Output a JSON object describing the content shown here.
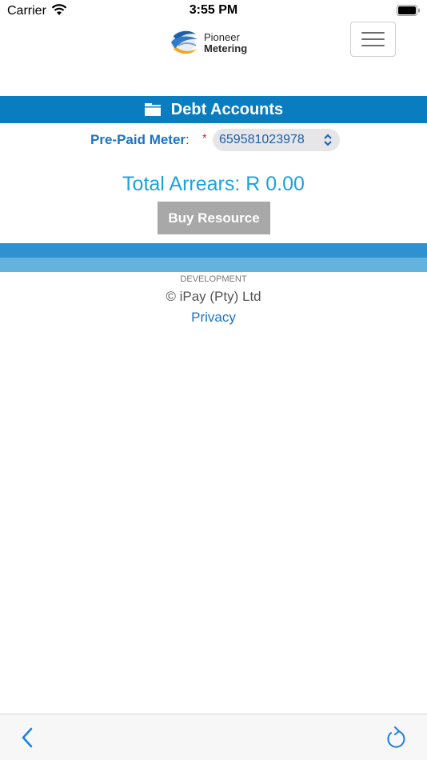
{
  "status_bar": {
    "carrier": "Carrier",
    "time": "3:55 PM"
  },
  "header": {
    "logo_line1": "Pioneer",
    "logo_line2": "Metering"
  },
  "page": {
    "title": "Debt Accounts"
  },
  "meter": {
    "label": "Pre-Paid Meter",
    "colon": ":",
    "required_mark": "*",
    "selected_value": "659581023978"
  },
  "arrears": {
    "text": "Total Arrears: R 0.00"
  },
  "actions": {
    "buy_label": "Buy Resource"
  },
  "footer": {
    "environment": "DEVELOPMENT",
    "copyright": "© iPay (Pty) Ltd",
    "privacy": "Privacy"
  },
  "colors": {
    "brand_blue": "#0a7dc0",
    "stripe_dark": "#2e91d0",
    "stripe_light": "#63b3de",
    "arrears_blue": "#1aa3dc",
    "button_gray": "#a8a8a8"
  }
}
